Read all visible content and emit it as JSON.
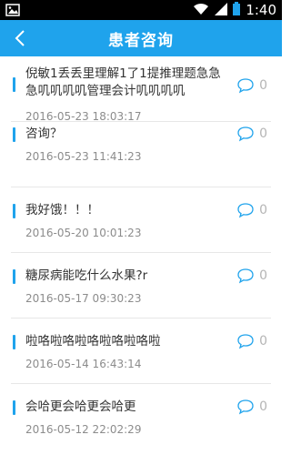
{
  "status_bar": {
    "time": "1:40"
  },
  "header": {
    "title": "患者咨询",
    "back_icon": "chevron-left-icon"
  },
  "colors": {
    "accent": "#1fa3ec",
    "title_text": "#333333",
    "date_text": "#8c8c8c",
    "divider": "#e7e7e7"
  },
  "items": [
    {
      "title": "倪敏1丢丢里理解1了1提推理题急急急叽叽叽叽管理会计叽叽叽叽",
      "date": "2016-05-23 18:03:17",
      "comments": "0"
    },
    {
      "title": "咨询？",
      "date": "2016-05-23 11:41:23",
      "comments": "0"
    },
    {
      "title": "我好饿！！！",
      "date": "2016-05-20 10:01:23",
      "comments": "0"
    },
    {
      "title": "糖尿病能吃什么水果?r",
      "date": "2016-05-17 09:30:23",
      "comments": "0"
    },
    {
      "title": "啦咯啦咯啦咯啦咯啦咯啦",
      "date": "2016-05-14 16:43:14",
      "comments": "0"
    },
    {
      "title": "会哈更会哈更会哈更",
      "date": "2016-05-12 22:02:29",
      "comments": "0"
    }
  ]
}
